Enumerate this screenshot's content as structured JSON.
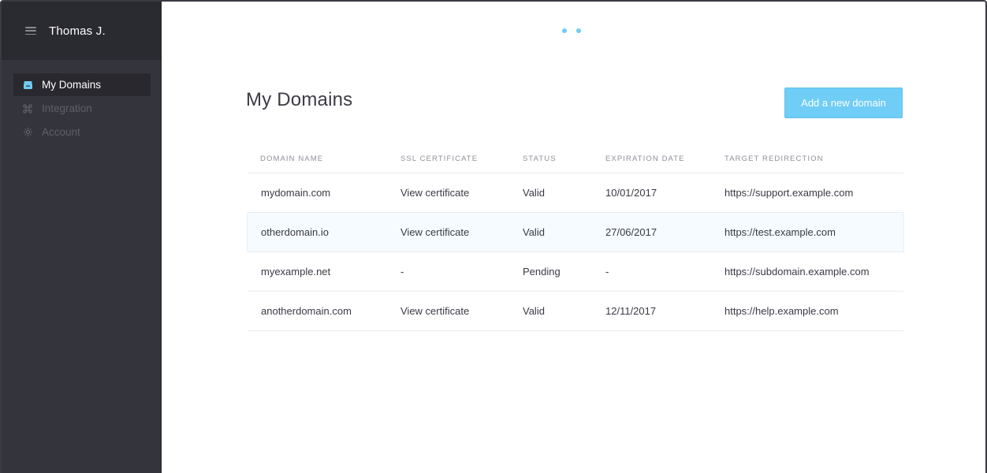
{
  "sidebar": {
    "user_name": "Thomas J.",
    "menu_icon": "hamburger-menu-icon",
    "items": [
      {
        "label": "My Domains",
        "icon": "domains-icon",
        "active": true
      },
      {
        "label": "Integration",
        "icon": "command-icon",
        "active": false
      },
      {
        "label": "Account",
        "icon": "gear-icon",
        "active": false
      }
    ]
  },
  "main": {
    "title": "My Domains",
    "add_button_label": "Add a new domain",
    "table": {
      "headers": [
        "DOMAIN NAME",
        "SSL CERTIFICATE",
        "STATUS",
        "EXPIRATION DATE",
        "TARGET REDIRECTION"
      ],
      "rows": [
        {
          "domain": "mydomain.com",
          "ssl": "View certificate",
          "status": "Valid",
          "expiration": "10/01/2017",
          "target": "https://support.example.com"
        },
        {
          "domain": "otherdomain.io",
          "ssl": "View certificate",
          "status": "Valid",
          "expiration": "27/06/2017",
          "target": "https://test.example.com"
        },
        {
          "domain": "myexample.net",
          "ssl": "-",
          "status": "Pending",
          "expiration": "-",
          "target": "https://subdomain.example.com"
        },
        {
          "domain": "anotherdomain.com",
          "ssl": "View certificate",
          "status": "Valid",
          "expiration": "12/11/2017",
          "target": "https://help.example.com"
        }
      ]
    }
  },
  "colors": {
    "accent": "#6fcdf6",
    "sidebar_bg": "#34343c",
    "sidebar_header_bg": "#2a2a31",
    "row_highlight": "#f5fbfe"
  }
}
